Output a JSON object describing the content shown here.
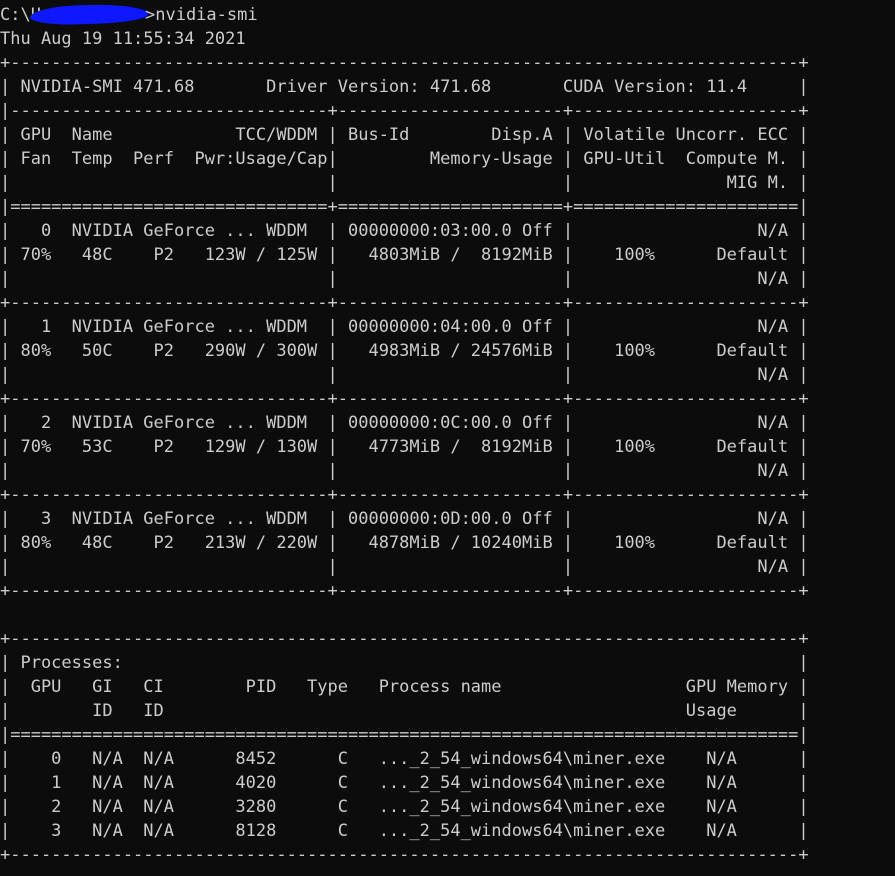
{
  "window": {
    "prompt_prefix": "C:\\Us",
    "command": ">nvidia-smi"
  },
  "timestamp": "Thu Aug 19 11:55:34 2021",
  "smi": {
    "version": "471.68",
    "driver_version": "471.68",
    "cuda_version": "11.4"
  },
  "gpus": [
    {
      "id": "0",
      "name": "NVIDIA GeForce ...",
      "mode": "WDDM",
      "bus_id": "00000000:03:00.0",
      "disp": "Off",
      "ecc": "N/A",
      "fan": "70%",
      "temp": "48C",
      "perf": "P2",
      "pwr_usage": "123W",
      "pwr_cap": "125W",
      "mem_used": "4803MiB",
      "mem_total": "8192MiB",
      "util": "100%",
      "compute": "Default",
      "mig": "N/A"
    },
    {
      "id": "1",
      "name": "NVIDIA GeForce ...",
      "mode": "WDDM",
      "bus_id": "00000000:04:00.0",
      "disp": "Off",
      "ecc": "N/A",
      "fan": "80%",
      "temp": "50C",
      "perf": "P2",
      "pwr_usage": "290W",
      "pwr_cap": "300W",
      "mem_used": "4983MiB",
      "mem_total": "24576MiB",
      "util": "100%",
      "compute": "Default",
      "mig": "N/A"
    },
    {
      "id": "2",
      "name": "NVIDIA GeForce ...",
      "mode": "WDDM",
      "bus_id": "00000000:0C:00.0",
      "disp": "Off",
      "ecc": "N/A",
      "fan": "70%",
      "temp": "53C",
      "perf": "P2",
      "pwr_usage": "129W",
      "pwr_cap": "130W",
      "mem_used": "4773MiB",
      "mem_total": "8192MiB",
      "util": "100%",
      "compute": "Default",
      "mig": "N/A"
    },
    {
      "id": "3",
      "name": "NVIDIA GeForce ...",
      "mode": "WDDM",
      "bus_id": "00000000:0D:00.0",
      "disp": "Off",
      "ecc": "N/A",
      "fan": "80%",
      "temp": "48C",
      "perf": "P2",
      "pwr_usage": "213W",
      "pwr_cap": "220W",
      "mem_used": "4878MiB",
      "mem_total": "10240MiB",
      "util": "100%",
      "compute": "Default",
      "mig": "N/A"
    }
  ],
  "processes": [
    {
      "gpu": "0",
      "gi": "N/A",
      "ci": "N/A",
      "pid": "8452",
      "type": "C",
      "name": "..._2_54_windows64\\miner.exe",
      "mem": "N/A"
    },
    {
      "gpu": "1",
      "gi": "N/A",
      "ci": "N/A",
      "pid": "4020",
      "type": "C",
      "name": "..._2_54_windows64\\miner.exe",
      "mem": "N/A"
    },
    {
      "gpu": "2",
      "gi": "N/A",
      "ci": "N/A",
      "pid": "3280",
      "type": "C",
      "name": "..._2_54_windows64\\miner.exe",
      "mem": "N/A"
    },
    {
      "gpu": "3",
      "gi": "N/A",
      "ci": "N/A",
      "pid": "8128",
      "type": "C",
      "name": "..._2_54_windows64\\miner.exe",
      "mem": "N/A"
    }
  ],
  "lines": {
    "l_sep": "+-----------------------------------------------------------------------------+",
    "l_info": "| NVIDIA-SMI 471.68       Driver Version: 471.68       CUDA Version: 11.4     |",
    "l_dash": "|-------------------------------+----------------------+----------------------+",
    "l_h1": "| GPU  Name            TCC/WDDM | Bus-Id        Disp.A | Volatile Uncorr. ECC |",
    "l_h2": "| Fan  Temp  Perf  Pwr:Usage/Cap|         Memory-Usage | GPU-Util  Compute M. |",
    "l_h3": "|                               |                      |               MIG M. |",
    "l_eq": "|===============================+======================+======================|",
    "g0a": "|   0  NVIDIA GeForce ... WDDM  | 00000000:03:00.0 Off |                  N/A |",
    "g0b": "| 70%   48C    P2   123W / 125W |   4803MiB /  8192MiB |    100%      Default |",
    "g0c": "|                               |                      |                  N/A |",
    "g_sep": "+-------------------------------+----------------------+----------------------+",
    "g1a": "|   1  NVIDIA GeForce ... WDDM  | 00000000:04:00.0 Off |                  N/A |",
    "g1b": "| 80%   50C    P2   290W / 300W |   4983MiB / 24576MiB |    100%      Default |",
    "g1c": "|                               |                      |                  N/A |",
    "g2a": "|   2  NVIDIA GeForce ... WDDM  | 00000000:0C:00.0 Off |                  N/A |",
    "g2b": "| 70%   53C    P2   129W / 130W |   4773MiB /  8192MiB |    100%      Default |",
    "g2c": "|                               |                      |                  N/A |",
    "g3a": "|   3  NVIDIA GeForce ... WDDM  | 00000000:0D:00.0 Off |                  N/A |",
    "g3b": "| 80%   48C    P2   213W / 220W |   4878MiB / 10240MiB |    100%      Default |",
    "g3c": "|                               |                      |                  N/A |",
    "p_title": "| Processes:                                                                  |",
    "p_h1": "|  GPU   GI   CI        PID   Type   Process name                  GPU Memory |",
    "p_h2": "|        ID   ID                                                   Usage      |",
    "p_eq": "|=============================================================================|",
    "p0": "|    0   N/A  N/A      8452      C   ..._2_54_windows64\\miner.exe    N/A      |",
    "p1": "|    1   N/A  N/A      4020      C   ..._2_54_windows64\\miner.exe    N/A      |",
    "p2": "|    2   N/A  N/A      3280      C   ..._2_54_windows64\\miner.exe    N/A      |",
    "p3": "|    3   N/A  N/A      8128      C   ..._2_54_windows64\\miner.exe    N/A      |"
  }
}
